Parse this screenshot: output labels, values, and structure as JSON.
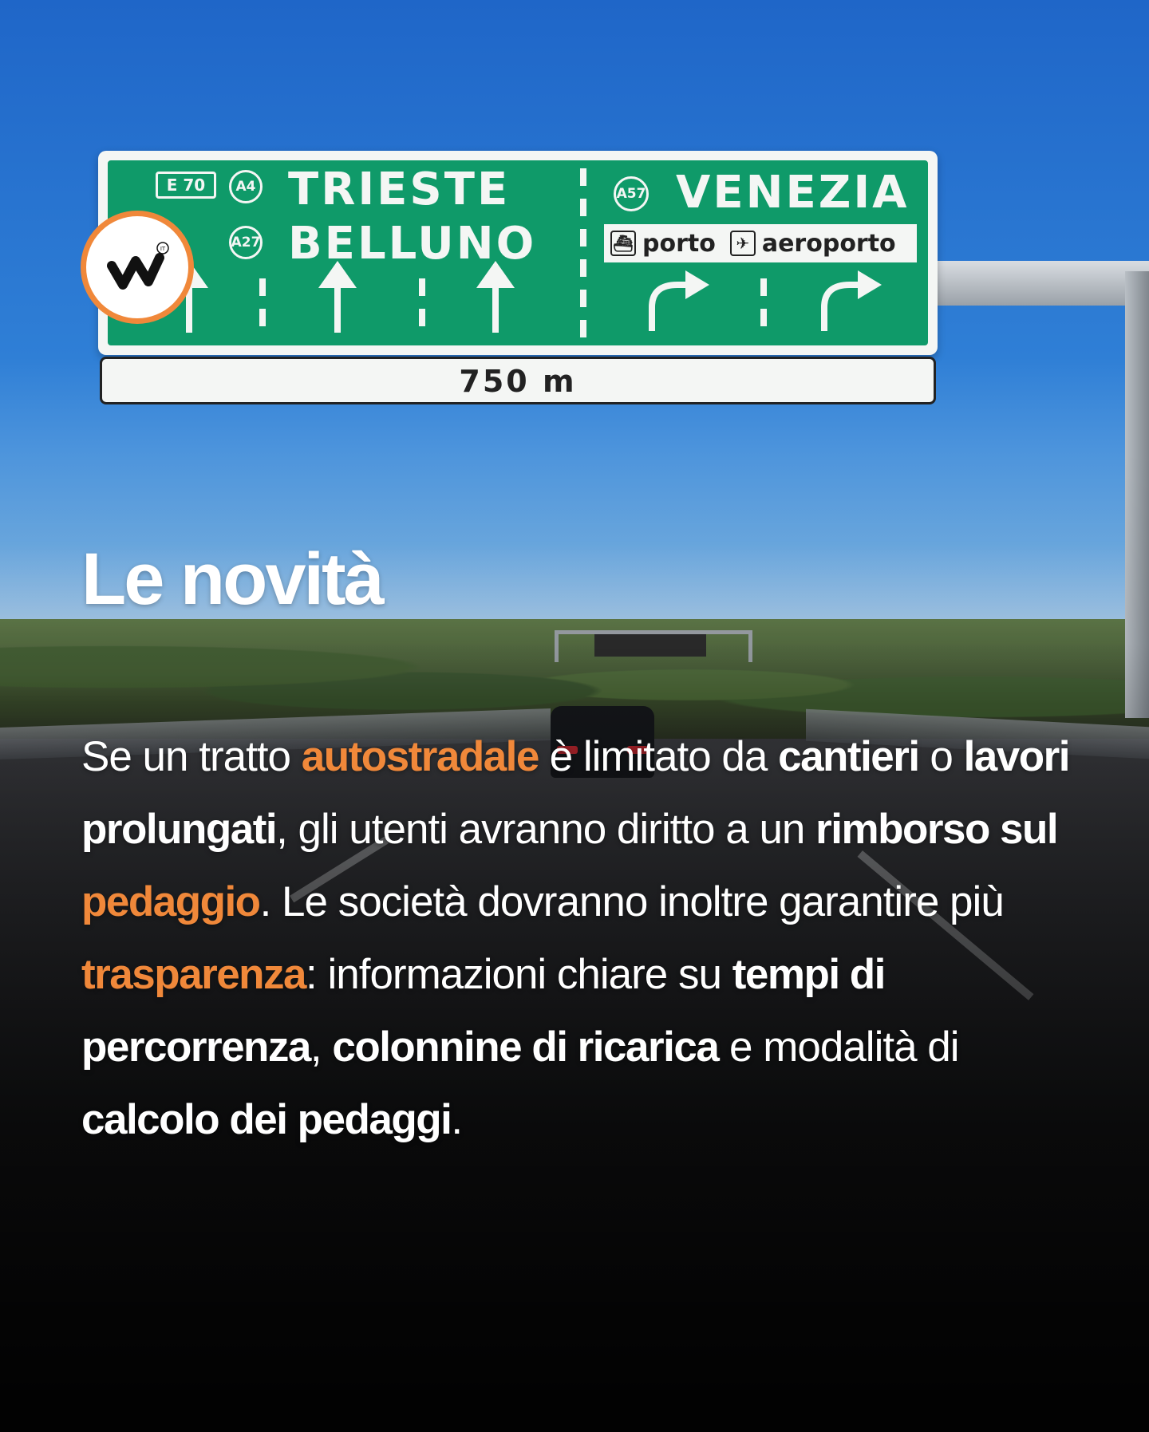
{
  "brand": {
    "accent_color": "#f0883a",
    "logo_icon": "wn-logo-icon",
    "logo_superscript": "IT"
  },
  "sign": {
    "badges": {
      "e70": "E 70",
      "a4": "A4",
      "a27": "A27",
      "a57": "A57"
    },
    "dest_trieste": "TRIESTE",
    "dest_belluno": "BELLUNO",
    "dest_venezia": "VENEZIA",
    "porto": "porto",
    "aeroporto": "aeroporto",
    "distance": "750 m",
    "port_icon": "ship-icon",
    "airport_icon": "airplane-icon"
  },
  "heading": "Le novità",
  "body": {
    "s1": "Se un tratto ",
    "s2": "autostradale",
    "s3": " è limitato da ",
    "s4": "cantieri",
    "s5": " o ",
    "s6": "lavori prolungati",
    "s7": ", gli utenti avranno diritto a un ",
    "s8": "rimborso sul ",
    "s9": "pedaggio",
    "s10": ". Le società dovranno inoltre garantire più ",
    "s11": "trasparenza",
    "s12": ": informazioni chiare su ",
    "s13": "tempi di percorrenza",
    "s14": ", ",
    "s15": "colonnine di ricarica",
    "s16": " e modalità di ",
    "s17": "calcolo dei pedaggi",
    "s18": "."
  }
}
